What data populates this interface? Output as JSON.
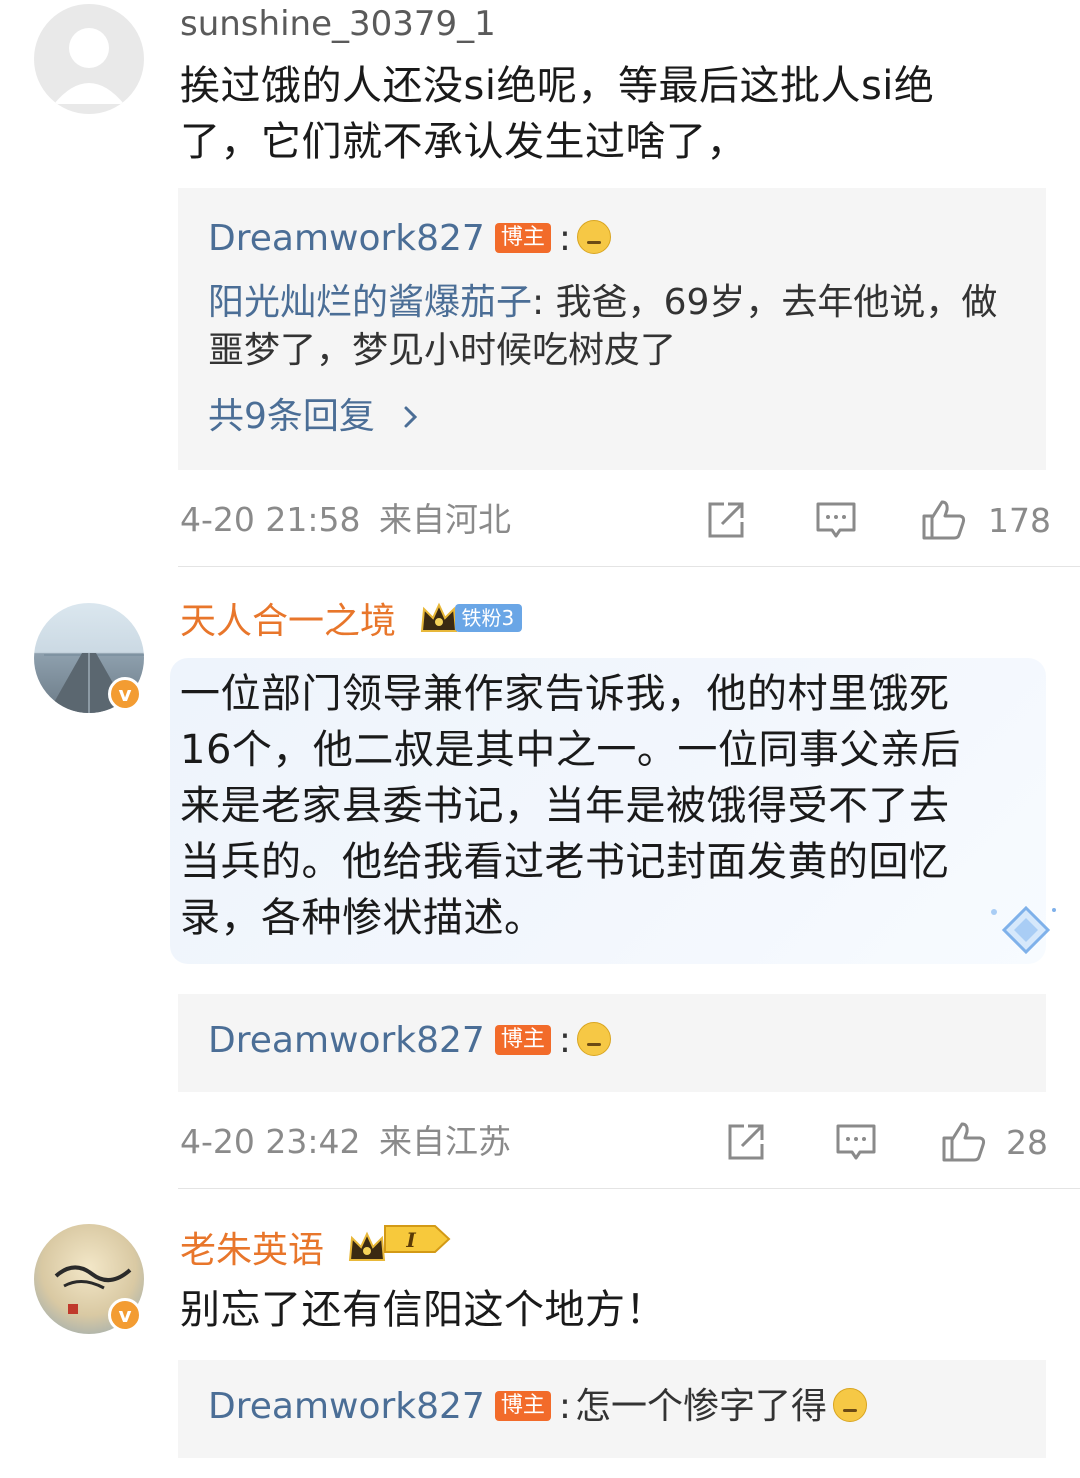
{
  "comments": [
    {
      "username": "sunshine_30379_1",
      "text": "挨过饿的人还没si绝呢，等最后这批人si绝了，它们就不承认发生过啥了，",
      "text_lines": [
        "挨过饿的人还没si绝呢，等最后这批人si绝",
        "了，它们就不承认发生过啥了，"
      ],
      "reply_author": "Dreamwork827",
      "reply_tag": "博主",
      "reply_text": "",
      "sub_reply_author": "阳光灿烂的酱爆茄子",
      "sub_reply_lines": [
        "我爸，69岁，去年他说，做",
        "噩梦了，梦见小时候吃树皮了"
      ],
      "more_replies": "共9条回复",
      "timestamp": "4-20 21:58",
      "location": "来自河北",
      "likes": "178"
    },
    {
      "username": "天人合一之境",
      "fan_badge": "铁粉3",
      "text_lines": [
        "一位部门领导兼作家告诉我，他的村里饿死",
        "16个，他二叔是其中之一。一位同事父亲后",
        "来是老家县委书记，当年是被饿得受不了去",
        "当兵的。他给我看过老书记封面发黄的回忆",
        "录，各种惨状描述。"
      ],
      "reply_author": "Dreamwork827",
      "reply_tag": "博主",
      "reply_text": "",
      "timestamp": "4-20 23:42",
      "location": "来自江苏",
      "likes": "28"
    },
    {
      "username": "老朱英语",
      "level_badge": "I",
      "text_lines": [
        "别忘了还有信阳这个地方！"
      ],
      "reply_author": "Dreamwork827",
      "reply_tag": "博主",
      "reply_text": "怎一个惨字了得"
    }
  ],
  "colors": {
    "link_blue": "#4b6e96",
    "orange_name": "#e8762b",
    "host_tag": "#f26b2a",
    "meta_gray": "#8a8a8a"
  }
}
